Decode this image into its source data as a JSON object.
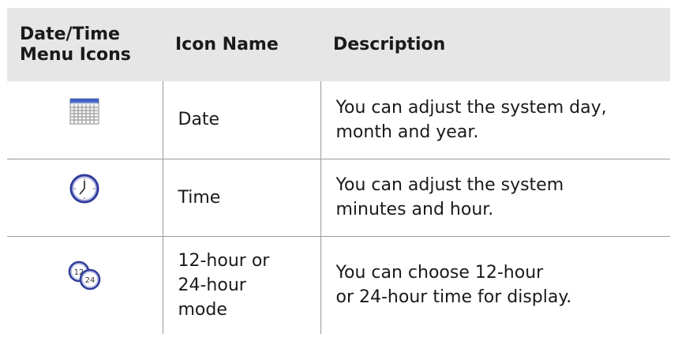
{
  "header": {
    "icons_col_line1": "Date/Time",
    "icons_col_line2": "Menu Icons",
    "name_col": "Icon Name",
    "desc_col": "Description"
  },
  "rows": [
    {
      "icon": "calendar-icon",
      "name_lines": [
        "Date"
      ],
      "desc_lines": [
        "You can adjust the system day,",
        "month and year."
      ]
    },
    {
      "icon": "clock-icon",
      "name_lines": [
        "Time"
      ],
      "desc_lines": [
        "You can adjust the system",
        "minutes and hour."
      ]
    },
    {
      "icon": "12-24-clock-icon",
      "icon_labels": [
        "12",
        "24"
      ],
      "name_lines": [
        "12-hour or",
        "24-hour",
        "mode"
      ],
      "desc_lines": [
        "You can choose 12-hour",
        "or 24-hour time for display."
      ]
    }
  ],
  "colors": {
    "header_bg": "#e6e6e6",
    "grid_line": "#9a9a9a",
    "clock_rim": "#2e3a9a"
  }
}
